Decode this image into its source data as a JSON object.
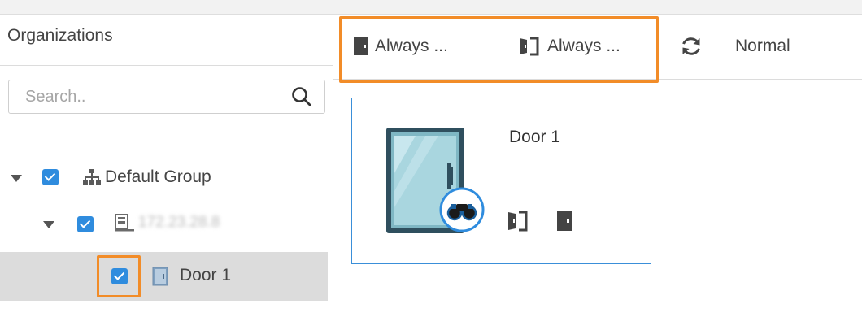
{
  "organizations_panel": {
    "title": "Organizations",
    "search": {
      "placeholder": "Search..",
      "value": ""
    },
    "tree": [
      {
        "label": "Default Group",
        "checked": true,
        "expanded": true,
        "icon": "org-tree-icon"
      },
      {
        "label": "172.23.28.8",
        "checked": true,
        "expanded": true,
        "icon": "device-icon",
        "obscured": true
      },
      {
        "label": "Door 1",
        "checked": true,
        "icon": "door-icon",
        "selected": true
      }
    ]
  },
  "toolbar": {
    "always_close_label": "Always ...",
    "always_open_label": "Always ...",
    "normal_label": "Normal"
  },
  "door_card": {
    "name": "Door 1",
    "status_icons": [
      "door-open-icon",
      "door-closed-icon"
    ]
  },
  "colors": {
    "accent_blue": "#2f8cde",
    "highlight_orange": "#f28c28",
    "card_border": "#3a8fd9",
    "selected_row": "#dcdcdc"
  }
}
